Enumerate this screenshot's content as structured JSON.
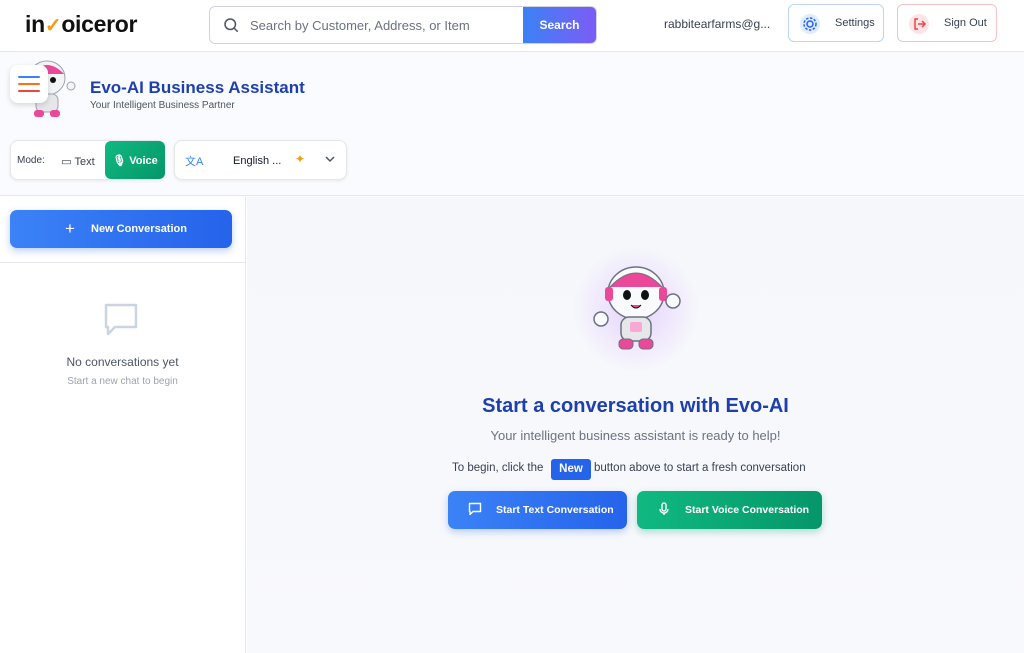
{
  "header": {
    "logo_pre": "in",
    "logo_post": "oiceror",
    "search_placeholder": "Search by Customer, Address, or Item",
    "search_value": "",
    "search_button": "Search",
    "user_email": "rabbitearfarms@g...",
    "settings_label": "Settings",
    "signout_label": "Sign Out"
  },
  "assistant": {
    "title": "Evo-AI Business Assistant",
    "subtitle": "Your Intelligent Business Partner",
    "mode_label": "Mode:",
    "mode_text": "Text",
    "mode_voice": "Voice",
    "selected_mode": "Voice",
    "language_value": "English ..."
  },
  "sidebar": {
    "new_conversation": "New Conversation",
    "empty_title": "No conversations yet",
    "empty_subtitle": "Start a new chat to begin"
  },
  "main": {
    "title": "Start a conversation with Evo-AI",
    "subtitle": "Your intelligent business assistant is ready to help!",
    "hint_pre": "To begin, click the",
    "hint_chip": "New",
    "hint_post": "button above to start a fresh conversation",
    "start_text": "Start Text Conversation",
    "start_voice": "Start Voice Conversation"
  },
  "colors": {
    "primary_blue": "#2563eb",
    "title_blue": "#1e40af",
    "voice_green": "#10b981",
    "logo_check": "#f59e0b",
    "mascot_pink": "#ec4899"
  },
  "icons": [
    "search-icon",
    "gear-icon",
    "sign-out-icon",
    "hamburger-icon",
    "message-icon",
    "microphone-icon",
    "translate-icon",
    "sparkle-icon",
    "chevron-down-icon",
    "plus-icon",
    "chat-bubble-icon",
    "robot-mascot-icon"
  ]
}
